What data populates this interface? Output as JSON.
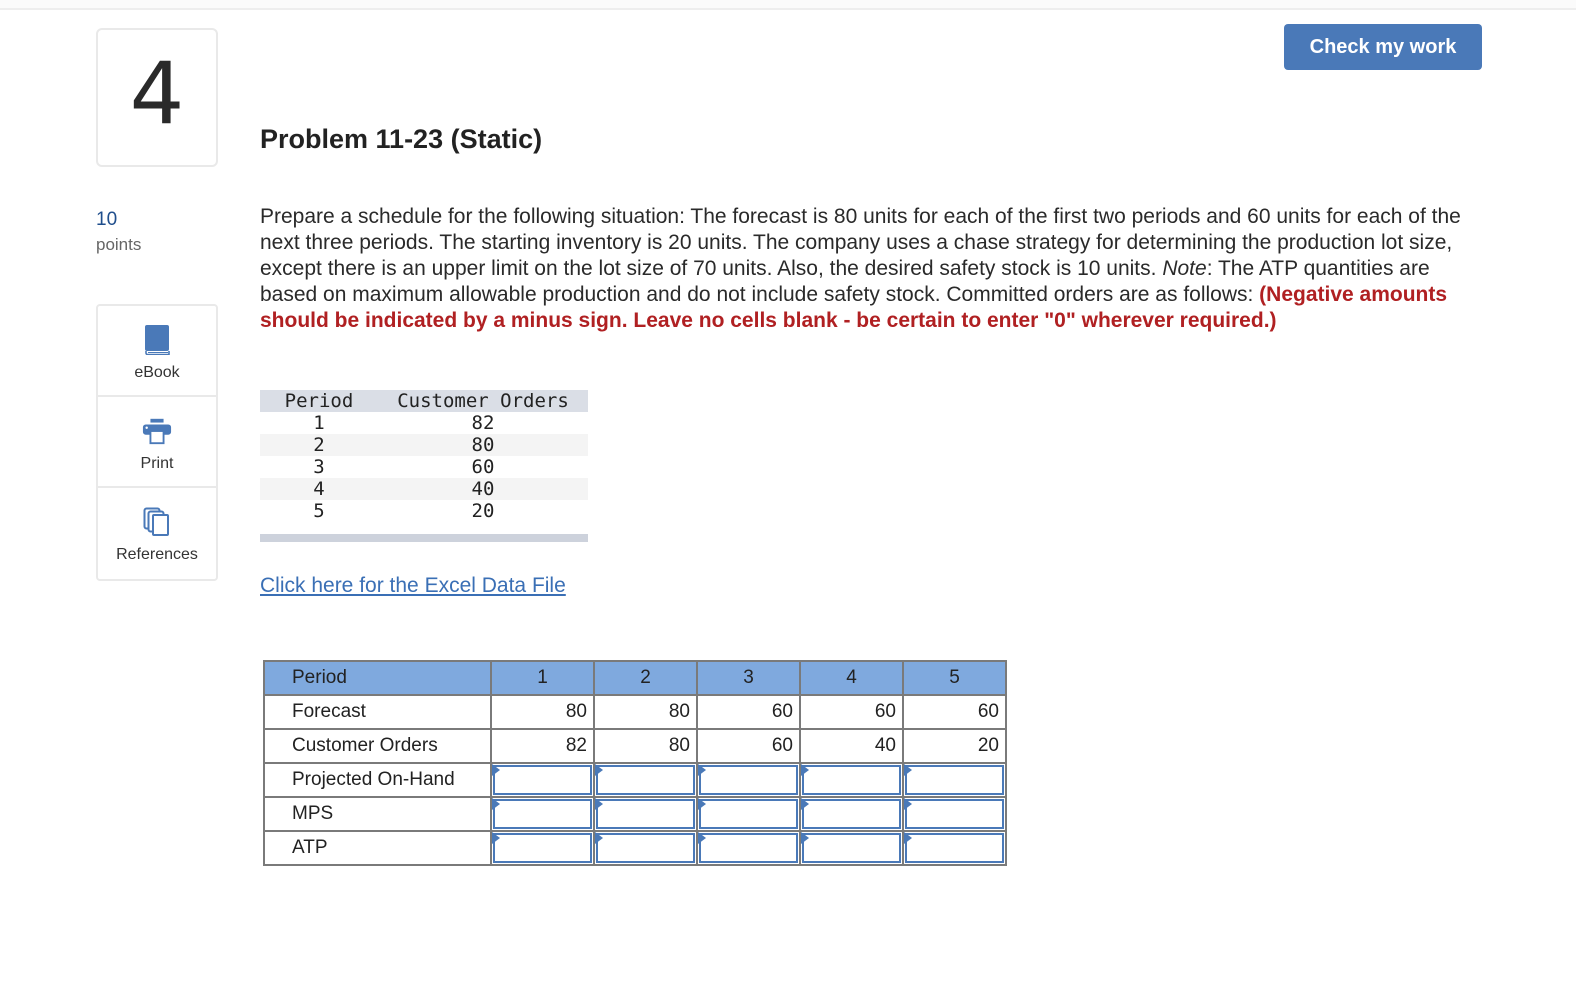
{
  "question": {
    "number": "4",
    "points_value": "10",
    "points_label": "points",
    "title": "Problem 11-23 (Static)"
  },
  "header": {
    "check_button_label": "Check my work"
  },
  "tools": [
    {
      "label": "eBook",
      "icon": "book-icon"
    },
    {
      "label": "Print",
      "icon": "printer-icon"
    },
    {
      "label": "References",
      "icon": "copy-stack-icon"
    }
  ],
  "prompt": {
    "text_a": "Prepare a schedule for the following situation: The forecast is 80 units for each of the first two periods and 60 units for each of the next three periods. The starting inventory is 20 units. The company uses a chase strategy for determining the production lot size, except there is an upper limit on the lot size of 70 units. Also, the desired safety stock is 10 units. ",
    "note_label": "Note",
    "text_b": ": The ATP quantities are based on maximum allowable production and do not include safety stock. Committed orders are as follows: ",
    "warning": "(Negative amounts should be indicated by a minus sign. Leave no cells blank - be certain to enter \"0\" wherever required.)"
  },
  "orders_table": {
    "headers": [
      "Period",
      "Customer Orders"
    ],
    "rows": [
      [
        "1",
        "82"
      ],
      [
        "2",
        "80"
      ],
      [
        "3",
        "60"
      ],
      [
        "4",
        "40"
      ],
      [
        "5",
        "20"
      ]
    ]
  },
  "excel_link_label": "Click here for the Excel Data File",
  "schedule": {
    "header_label": "Period",
    "periods": [
      "1",
      "2",
      "3",
      "4",
      "5"
    ],
    "forecast_label": "Forecast",
    "forecast": [
      "80",
      "80",
      "60",
      "60",
      "60"
    ],
    "orders_label": "Customer Orders",
    "orders": [
      "82",
      "80",
      "60",
      "40",
      "20"
    ],
    "input_rows": [
      {
        "label": "Projected On-Hand",
        "values": [
          "",
          "",
          "",
          "",
          ""
        ]
      },
      {
        "label": "MPS",
        "values": [
          "",
          "",
          "",
          "",
          ""
        ]
      },
      {
        "label": "ATP",
        "values": [
          "",
          "",
          "",
          "",
          ""
        ]
      }
    ]
  },
  "colors": {
    "accent": "#4a79b8",
    "header_fill": "#7fa9de",
    "warning": "#b02022",
    "link": "#3a6fb5"
  }
}
